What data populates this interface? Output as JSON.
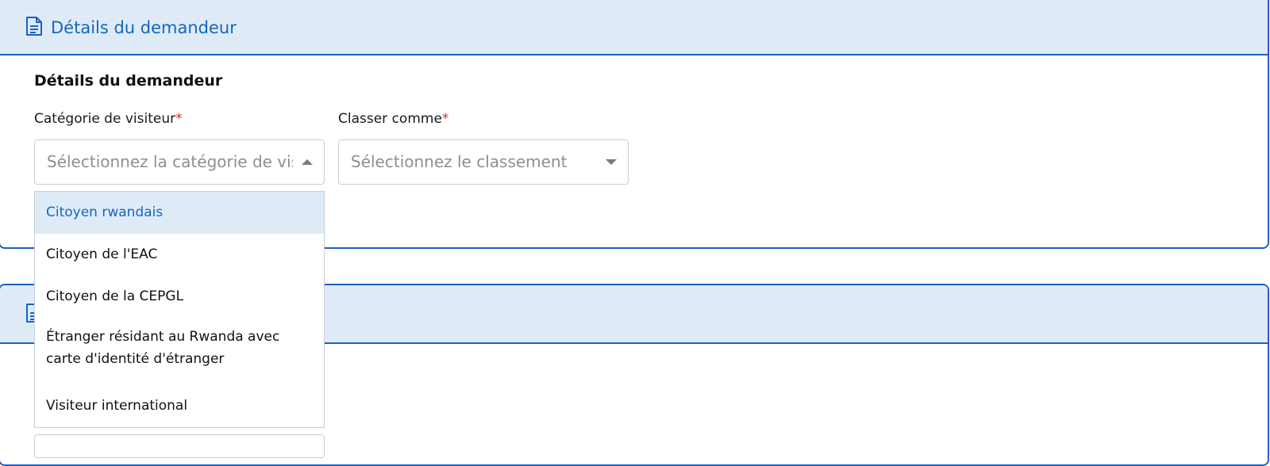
{
  "section1": {
    "header_title": "Détails du demandeur",
    "section_title": "Détails du demandeur",
    "visitor_category": {
      "label": "Catégorie de visiteur",
      "required_mark": "*",
      "placeholder": "Sélectionnez la catégorie de visiteur",
      "expanded": true,
      "options": [
        "Citoyen rwandais",
        "Citoyen de l'EAC",
        "Citoyen de la CEPGL",
        "Étranger résidant au Rwanda avec carte d'identité d'étranger",
        "Visiteur international"
      ],
      "highlighted_option": "Citoyen rwandais"
    },
    "classify_as": {
      "label": "Classer comme",
      "required_mark": "*",
      "placeholder": "Sélectionnez le classement"
    }
  },
  "section2": {
    "header_icon": "document-icon"
  },
  "colors": {
    "accent_blue": "#1565c0",
    "header_bg": "#deebf7",
    "border_blue": "#1f5fbf",
    "required_red": "#e0262b"
  }
}
